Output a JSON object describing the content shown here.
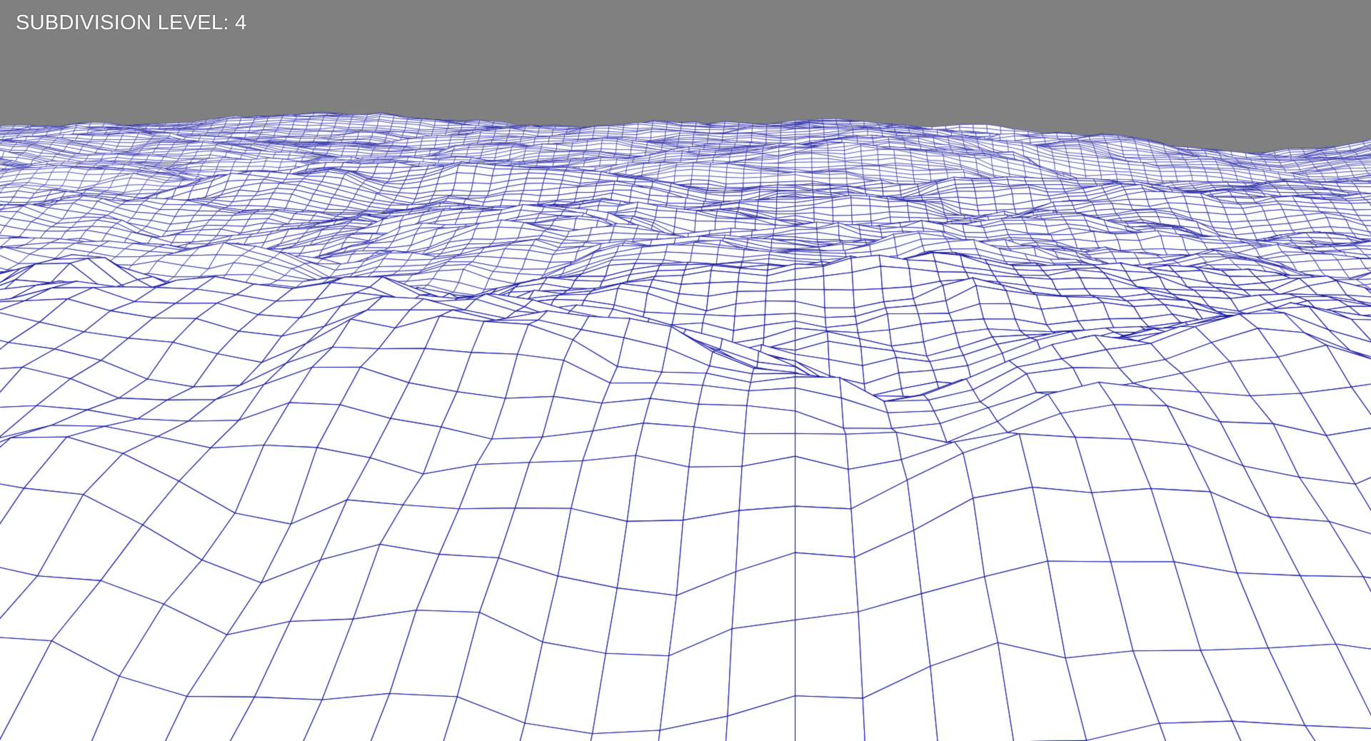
{
  "viewport": {
    "overlay_text": "SUBDIVISION LEVEL: 4",
    "background_color": "#808080",
    "wire_color": "#1a1aa0",
    "surface_color": "#ffffff",
    "subdivision_level": 4,
    "render_mode": "wireframe"
  }
}
